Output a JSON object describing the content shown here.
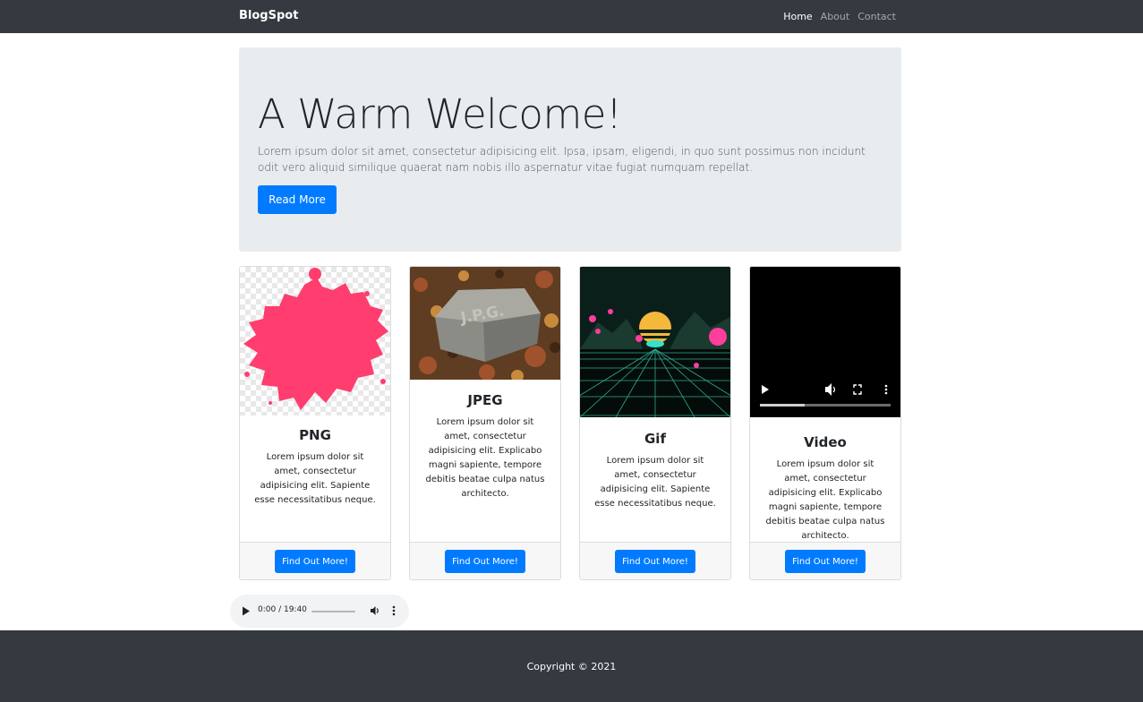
{
  "navbar": {
    "brand": "BlogSpot",
    "links": [
      {
        "label": "Home",
        "active": true
      },
      {
        "label": "About",
        "active": false
      },
      {
        "label": "Contact",
        "active": false
      }
    ]
  },
  "hero": {
    "title": "A Warm Welcome!",
    "text": "Lorem ipsum dolor sit amet, consectetur adipisicing elit. Ipsa, ipsam, eligendi, in quo sunt possimus non incidunt odit vero aliquid similique quaerat nam nobis illo aspernatur vitae fugiat numquam repellat.",
    "button": "Read More"
  },
  "cards": [
    {
      "title": "PNG",
      "text": "Lorem ipsum dolor sit amet, consectetur adipisicing elit. Sapiente esse necessitatibus neque.",
      "button": "Find Out More!",
      "media": "pink-paint-splash-on-transparent-background"
    },
    {
      "title": "JPEG",
      "text": "Lorem ipsum dolor sit amet, consectetur adipisicing elit. Explicabo magni sapiente, tempore debitis beatae culpa natus architecto.",
      "button": "Find Out More!",
      "media": "gravestone-in-autumn-leaves"
    },
    {
      "title": "Gif",
      "text": "Lorem ipsum dolor sit amet, consectetur adipisicing elit. Sapiente esse necessitatibus neque.",
      "button": "Find Out More!",
      "media": "retro-synthwave-grid-with-sun"
    },
    {
      "title": "Video",
      "text": "Lorem ipsum dolor sit amet, consectetur adipisicing elit. Explicabo magni sapiente, tempore debitis beatae culpa natus architecto.",
      "button": "Find Out More!",
      "media": "video-player"
    }
  ],
  "audio": {
    "time": "0:00 / 19:40"
  },
  "footer": {
    "copyright": "Copyright © 2021"
  },
  "colors": {
    "navbar_bg": "#343a40",
    "hero_bg": "#e9ecef",
    "primary": "#007bff",
    "card_footer_bg": "#f7f7f7",
    "paint_pink": "#ff3d6e"
  }
}
